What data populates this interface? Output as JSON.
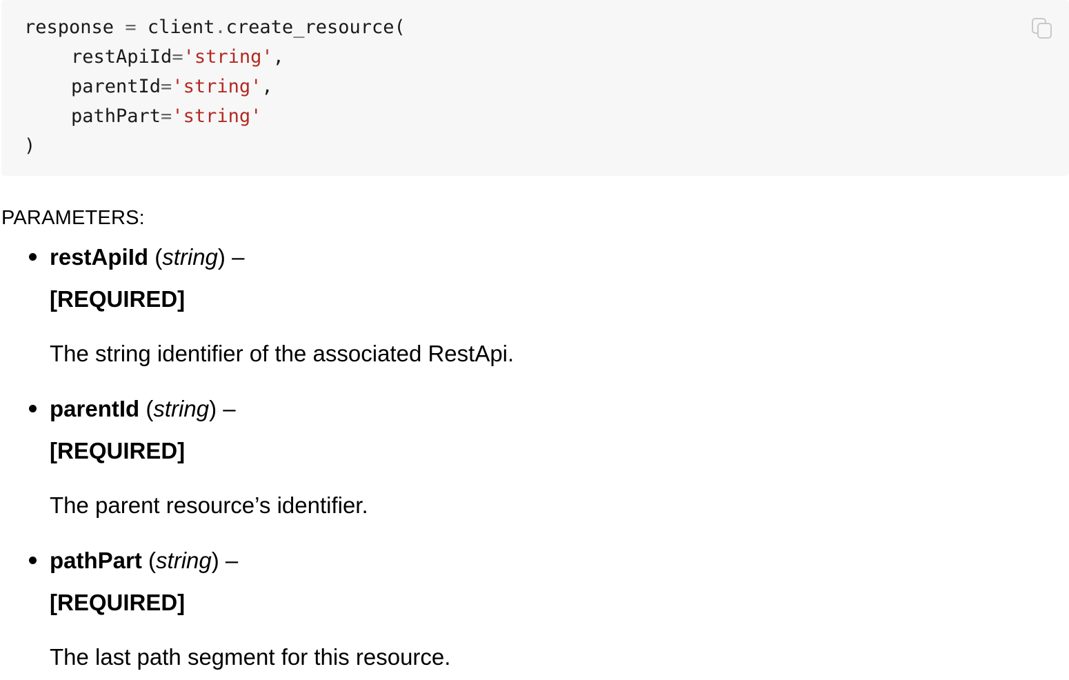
{
  "code": {
    "line1": {
      "var": "response",
      "eq": "=",
      "obj": "client",
      "dot": ".",
      "call": "create_resource("
    },
    "args": [
      {
        "name": "restApiId",
        "eq": "=",
        "value": "'string'",
        "sep": ","
      },
      {
        "name": "parentId",
        "eq": "=",
        "value": "'string'",
        "sep": ","
      },
      {
        "name": "pathPart",
        "eq": "=",
        "value": "'string'",
        "sep": ""
      }
    ],
    "close": ")",
    "copy_icon": "copy-icon"
  },
  "parameters": {
    "heading": "PARAMETERS:",
    "items": [
      {
        "name": "restApiId",
        "open": " (",
        "type": "string",
        "close": ") –",
        "required": "[REQUIRED]",
        "description": "The string identifier of the associated RestApi."
      },
      {
        "name": "parentId",
        "open": " (",
        "type": "string",
        "close": ") –",
        "required": "[REQUIRED]",
        "description": "The parent resource’s identifier."
      },
      {
        "name": "pathPart",
        "open": " (",
        "type": "string",
        "close": ") –",
        "required": "[REQUIRED]",
        "description": "The last path segment for this resource."
      }
    ]
  },
  "colors": {
    "code_bg": "#f7f7f7",
    "string_literal": "#b22a22",
    "operator": "#666666"
  }
}
